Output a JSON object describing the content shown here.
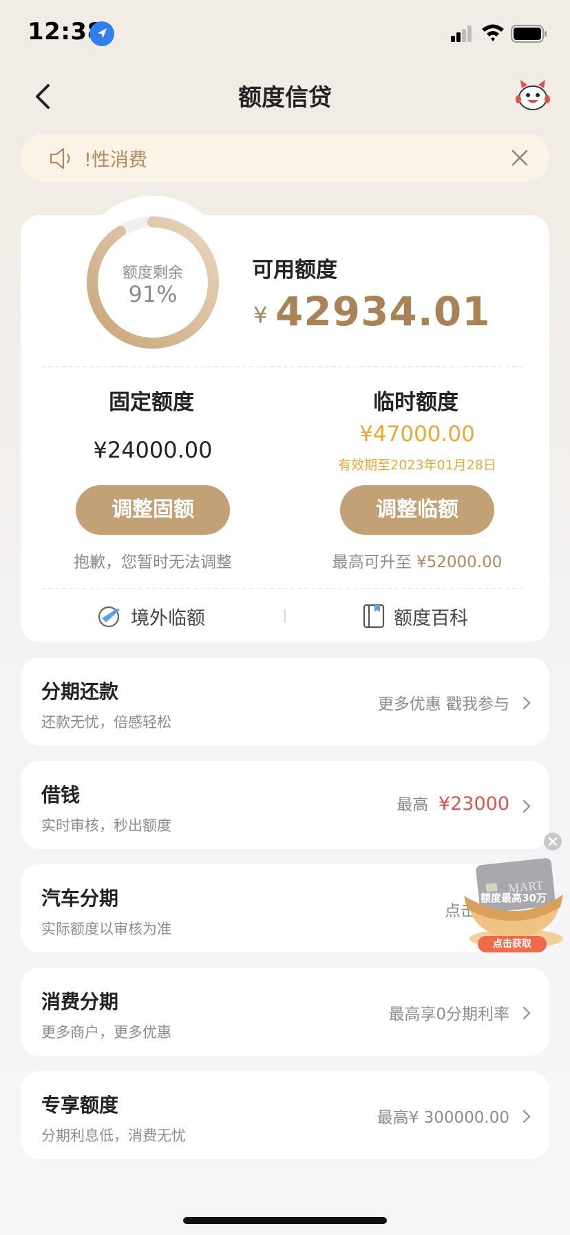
{
  "status_bar": {
    "time": "12:38"
  },
  "header": {
    "title": "额度信贷"
  },
  "notice": {
    "text": "!性消费"
  },
  "credit": {
    "ring_label": "额度剩余",
    "ring_percent": "91%",
    "ring_fraction": 0.91,
    "available_label": "可用额度",
    "currency": "¥",
    "available_value": "42934.01"
  },
  "fixed": {
    "title": "固定额度",
    "value": "¥24000.00",
    "button": "调整固额",
    "note": "抱歉，您暂时无法调整"
  },
  "temporary": {
    "title": "临时额度",
    "value": "¥47000.00",
    "expiry": "有效期至2023年01月28日",
    "button": "调整临额",
    "note_prefix": "最高可升至",
    "note_amount": "¥52000.00"
  },
  "links": {
    "overseas": "境外临额",
    "encyclopedia": "额度百科"
  },
  "items": [
    {
      "title": "分期还款",
      "subtitle": "还款无忧，倍感轻松",
      "right": "更多优惠 戳我参与"
    },
    {
      "title": "借钱",
      "subtitle": "实时审核，秒出额度",
      "right_prefix": "最高",
      "right_amount": "¥23000"
    },
    {
      "title": "汽车分期",
      "subtitle": "实际额度以审核为准",
      "right": "点击"
    },
    {
      "title": "消费分期",
      "subtitle": "更多商户，更多优惠",
      "right": "最高享0分期利率"
    },
    {
      "title": "专享额度",
      "subtitle": "分期利息低，消费无忧",
      "right": "最高¥ 300000.00"
    }
  ],
  "promo": {
    "text": "额度最高30万",
    "button": "点击获取",
    "card_text": "MART"
  },
  "colors": {
    "accent": "#c3a176",
    "gold_text": "#a88358",
    "orange": "#e8a838",
    "red": "#d9534f"
  }
}
